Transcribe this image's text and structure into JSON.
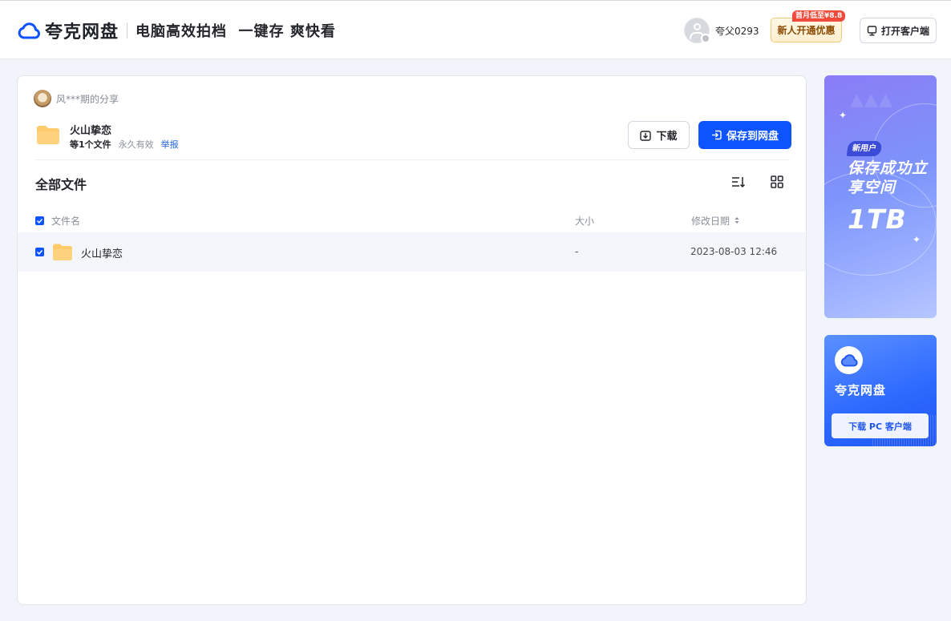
{
  "header": {
    "brand": "夸克网盘",
    "slogan": "电脑高效拍档  一键存 爽快看",
    "username": "夸父0293",
    "promo_label": "新人开通优惠",
    "promo_tag": "首月低至¥8.8",
    "open_client_label": "打开客户端"
  },
  "share": {
    "sharer": "风***期的分享",
    "folder_name": "火山挚恋",
    "file_count": "等1个文件",
    "validity": "永久有效",
    "report": "举报",
    "download_label": "下载",
    "save_label": "保存到网盘"
  },
  "files": {
    "section_title": "全部文件",
    "columns": {
      "name": "文件名",
      "size": "大小",
      "modified": "修改日期"
    },
    "rows": [
      {
        "name": "火山挚恋",
        "size": "-",
        "modified": "2023-08-03 12:46",
        "checked": true
      }
    ],
    "all_checked": true
  },
  "ads": {
    "ad1": {
      "badge": "新用户",
      "title": "保存成功立享空间",
      "highlight": "1TB"
    },
    "ad2": {
      "name": "夸克网盘",
      "button_label": "下载 PC 客户端"
    }
  },
  "colors": {
    "primary": "#0d53ff",
    "folder": "#ffcb6b",
    "link": "#1e62e6"
  }
}
